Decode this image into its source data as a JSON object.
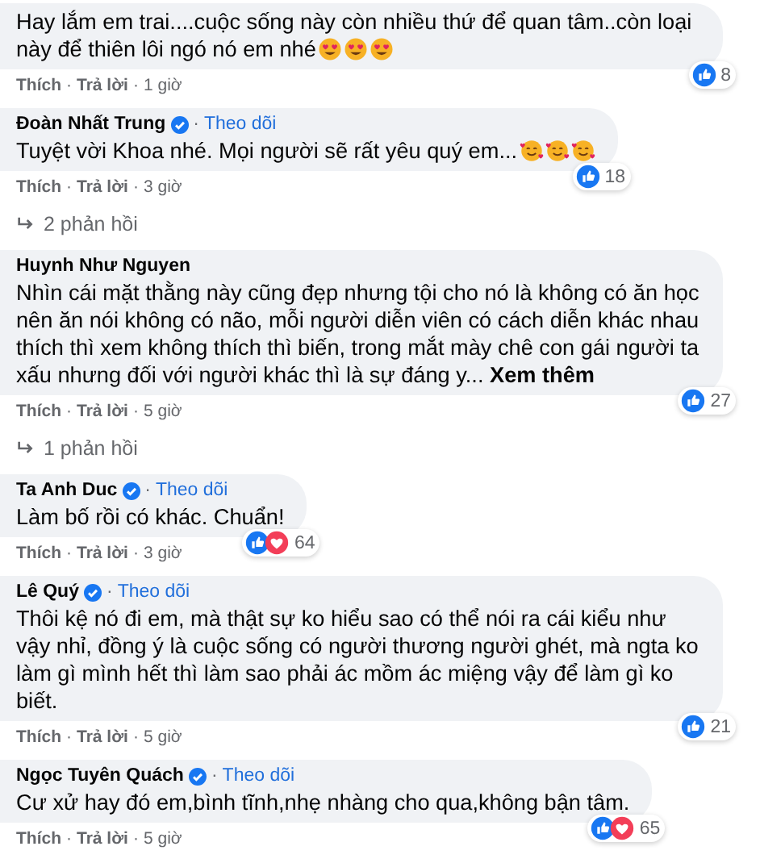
{
  "separator": "·",
  "thread": [
    {
      "kind": "comment",
      "verified": false,
      "text": "Hay lắm em trai....cuộc sống này còn nhiều thứ để quan tâm..còn loại này để thiên lôi ngó nó em nhé",
      "emojis": [
        {
          "kind": "heart_eyes"
        },
        {
          "kind": "heart_eyes"
        },
        {
          "kind": "heart_eyes"
        }
      ],
      "reactions": [
        {
          "kind": "like"
        }
      ],
      "count": "8",
      "like": "Thích",
      "reply": "Trả lời",
      "time": "1 giờ"
    },
    {
      "kind": "comment",
      "name": "Đoàn Nhất Trung",
      "verified": true,
      "follow": "Theo dõi",
      "text": "Tuyệt vời Khoa nhé. Mọi người sẽ rất yêu quý em...",
      "emojis": [
        {
          "kind": "smiling_hearts"
        },
        {
          "kind": "smiling_hearts"
        },
        {
          "kind": "smiling_hearts"
        }
      ],
      "reactions": [
        {
          "kind": "like"
        }
      ],
      "count": "18",
      "like": "Thích",
      "reply": "Trả lời",
      "time": "3 giờ"
    },
    {
      "kind": "replies",
      "label": "2 phản hồi"
    },
    {
      "kind": "comment",
      "name": "Huynh Như Nguyen",
      "verified": false,
      "text": "Nhìn cái mặt thằng này cũng đẹp nhưng tội cho nó là không có ăn học nên ăn nói không có não, mỗi người diễn viên có cách diễn khác nhau thích thì xem không thích thì biến, trong mắt mày chê con gái người ta xấu nhưng đối với người khác thì là sự đáng y... **Xem thêm**",
      "reactions": [
        {
          "kind": "like"
        }
      ],
      "count": "27",
      "like": "Thích",
      "reply": "Trả lời",
      "time": "5 giờ"
    },
    {
      "kind": "replies",
      "label": "1 phản hồi"
    },
    {
      "kind": "comment",
      "name": "Ta Anh Duc",
      "verified": true,
      "follow": "Theo dõi",
      "text": "Làm bố rồi có khác. Chuẩn!",
      "reactions": [
        {
          "kind": "like"
        },
        {
          "kind": "love"
        }
      ],
      "count": "64",
      "like": "Thích",
      "reply": "Trả lời",
      "time": "3 giờ"
    },
    {
      "kind": "comment",
      "name": "Lê Quý",
      "verified": true,
      "follow": "Theo dõi",
      "text": "Thôi kệ nó đi em, mà thật sự ko hiểu sao có thể nói ra cái kiểu như vậy nhỉ, đồng ý là cuộc sống có người thương người ghét, mà ngta ko làm gì mình hết thì làm sao phải ác mồm ác miệng vậy để làm gì ko biết.",
      "reactions": [
        {
          "kind": "like"
        }
      ],
      "count": "21",
      "like": "Thích",
      "reply": "Trả lời",
      "time": "5 giờ"
    },
    {
      "kind": "comment",
      "name": "Ngọc Tuyên Quách",
      "verified": true,
      "follow": "Theo dõi",
      "text": "Cư xử hay đó em,bình tĩnh,nhẹ nhàng cho qua,không bận tâm.",
      "reactions": [
        {
          "kind": "like"
        },
        {
          "kind": "love"
        }
      ],
      "count": "65",
      "like": "Thích",
      "reply": "Trả lời",
      "time": "5 giờ"
    }
  ]
}
